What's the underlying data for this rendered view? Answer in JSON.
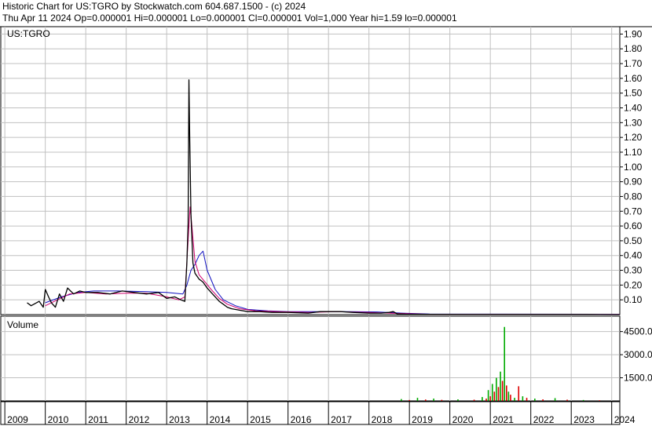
{
  "header": {
    "line1": "Historic Chart for US:TGRO by Stockwatch.com 604.687.1500 - (c) 2024",
    "line2": "Thu Apr 11 2024   Op=0.000001  Hi=0.000001  Lo=0.000001  Cl=0.000001  Vol=1,000  Year hi=1.59  lo=0.000001"
  },
  "colors": {
    "price": "#000000",
    "ma_short": "#d0006f",
    "ma_long": "#1010c0",
    "volume_up": "#00aa00",
    "volume_down": "#dd0000",
    "grid": "#c0c0c0"
  },
  "chart_data": [
    {
      "type": "line",
      "title": "US:TGRO",
      "ylim": [
        0,
        1.95
      ],
      "yticks": [
        "1.90",
        "1.80",
        "1.70",
        "1.60",
        "1.50",
        "1.40",
        "1.30",
        "1.20",
        "1.10",
        "1.00",
        "0.90",
        "0.80",
        "0.70",
        "0.60",
        "0.50",
        "0.40",
        "0.30",
        "0.20",
        "0.10"
      ],
      "grid": true,
      "x_tick_labels": [
        "2009",
        "2010",
        "2011",
        "2012",
        "2013",
        "2014",
        "2015",
        "2016",
        "2017",
        "2018",
        "2019",
        "2020",
        "2021",
        "2022",
        "2023",
        "2024"
      ],
      "xlim": [
        2008.9,
        2024.2
      ],
      "series": [
        {
          "role": "price",
          "x": [
            2009.55,
            2009.65,
            2009.85,
            2009.95,
            2010.0,
            2010.08,
            2010.15,
            2010.25,
            2010.35,
            2010.45,
            2010.55,
            2010.7,
            2010.85,
            2011.0,
            2011.3,
            2011.6,
            2011.9,
            2012.2,
            2012.5,
            2012.8,
            2013.0,
            2013.2,
            2013.35,
            2013.45,
            2013.5,
            2013.53,
            2013.55,
            2013.57,
            2013.6,
            2013.65,
            2013.7,
            2013.8,
            2013.9,
            2014.0,
            2014.1,
            2014.2,
            2014.3,
            2014.4,
            2014.5,
            2014.6,
            2014.8,
            2015.0,
            2015.3,
            2015.6,
            2016.0,
            2016.5,
            2016.8,
            2017.0,
            2017.3,
            2017.6,
            2018.0,
            2018.3,
            2018.5,
            2018.6,
            2018.7,
            2018.9,
            2019.5,
            2020.5,
            2021.5,
            2022.5,
            2023.5,
            2024.2
          ],
          "y": [
            0.08,
            0.06,
            0.09,
            0.05,
            0.17,
            0.12,
            0.08,
            0.05,
            0.14,
            0.09,
            0.18,
            0.14,
            0.16,
            0.15,
            0.15,
            0.14,
            0.16,
            0.15,
            0.14,
            0.15,
            0.11,
            0.12,
            0.1,
            0.09,
            0.35,
            0.62,
            1.59,
            1.2,
            0.68,
            0.35,
            0.28,
            0.24,
            0.22,
            0.18,
            0.15,
            0.12,
            0.09,
            0.07,
            0.05,
            0.04,
            0.03,
            0.02,
            0.02,
            0.015,
            0.015,
            0.01,
            0.02,
            0.02,
            0.02,
            0.015,
            0.01,
            0.01,
            0.015,
            0.02,
            0.005,
            0.003,
            0.002,
            0.001,
            0.001,
            0.001,
            0.001,
            1e-06
          ]
        },
        {
          "role": "ma_short",
          "x": [
            2010.0,
            2010.3,
            2010.6,
            2011.0,
            2011.5,
            2012.0,
            2012.5,
            2013.0,
            2013.3,
            2013.45,
            2013.52,
            2013.58,
            2013.63,
            2013.7,
            2013.8,
            2013.95,
            2014.1,
            2014.3,
            2014.5,
            2014.8,
            2015.2,
            2015.8,
            2016.5,
            2017.2,
            2018.0,
            2018.7,
            2019.5,
            2024.2
          ],
          "y": [
            0.06,
            0.1,
            0.14,
            0.15,
            0.14,
            0.145,
            0.145,
            0.12,
            0.1,
            0.12,
            0.45,
            0.73,
            0.58,
            0.36,
            0.27,
            0.22,
            0.17,
            0.11,
            0.07,
            0.04,
            0.025,
            0.02,
            0.015,
            0.02,
            0.015,
            0.008,
            0.002,
            0.001
          ]
        },
        {
          "role": "ma_long",
          "x": [
            2010.0,
            2010.4,
            2010.8,
            2011.2,
            2011.8,
            2012.5,
            2013.0,
            2013.4,
            2013.5,
            2013.6,
            2013.7,
            2013.8,
            2013.9,
            2014.0,
            2014.2,
            2014.4,
            2014.7,
            2015.0,
            2015.5,
            2016.0,
            2016.8,
            2017.5,
            2018.2,
            2018.8,
            2019.5,
            2024.2
          ],
          "y": [
            0.08,
            0.12,
            0.15,
            0.16,
            0.16,
            0.155,
            0.15,
            0.14,
            0.2,
            0.3,
            0.34,
            0.4,
            0.43,
            0.3,
            0.17,
            0.1,
            0.06,
            0.035,
            0.025,
            0.02,
            0.02,
            0.02,
            0.018,
            0.01,
            0.004,
            0.002
          ]
        }
      ]
    },
    {
      "type": "bar",
      "title": "Volume",
      "ylim": [
        0,
        5500
      ],
      "yticks": [
        "4500.0",
        "3000.0",
        "1500.0"
      ],
      "grid": true,
      "xlim": [
        2008.9,
        2024.2
      ],
      "bars": [
        {
          "x": 2018.8,
          "v": 120,
          "dir": "up"
        },
        {
          "x": 2019.0,
          "v": 60,
          "dir": "down"
        },
        {
          "x": 2019.2,
          "v": 200,
          "dir": "up"
        },
        {
          "x": 2019.4,
          "v": 90,
          "dir": "down"
        },
        {
          "x": 2019.6,
          "v": 150,
          "dir": "up"
        },
        {
          "x": 2019.8,
          "v": 70,
          "dir": "down"
        },
        {
          "x": 2020.2,
          "v": 100,
          "dir": "up"
        },
        {
          "x": 2020.6,
          "v": 80,
          "dir": "down"
        },
        {
          "x": 2020.8,
          "v": 250,
          "dir": "up"
        },
        {
          "x": 2020.9,
          "v": 150,
          "dir": "down"
        },
        {
          "x": 2020.95,
          "v": 700,
          "dir": "up"
        },
        {
          "x": 2021.0,
          "v": 300,
          "dir": "down"
        },
        {
          "x": 2021.05,
          "v": 1100,
          "dir": "up"
        },
        {
          "x": 2021.1,
          "v": 600,
          "dir": "down"
        },
        {
          "x": 2021.15,
          "v": 1500,
          "dir": "up"
        },
        {
          "x": 2021.2,
          "v": 900,
          "dir": "down"
        },
        {
          "x": 2021.25,
          "v": 1900,
          "dir": "up"
        },
        {
          "x": 2021.3,
          "v": 1300,
          "dir": "down"
        },
        {
          "x": 2021.35,
          "v": 4800,
          "dir": "up"
        },
        {
          "x": 2021.4,
          "v": 1000,
          "dir": "down"
        },
        {
          "x": 2021.45,
          "v": 600,
          "dir": "up"
        },
        {
          "x": 2021.5,
          "v": 400,
          "dir": "down"
        },
        {
          "x": 2021.6,
          "v": 200,
          "dir": "up"
        },
        {
          "x": 2021.7,
          "v": 950,
          "dir": "down"
        },
        {
          "x": 2021.8,
          "v": 300,
          "dir": "up"
        },
        {
          "x": 2021.9,
          "v": 200,
          "dir": "down"
        },
        {
          "x": 2022.1,
          "v": 150,
          "dir": "up"
        },
        {
          "x": 2022.3,
          "v": 100,
          "dir": "down"
        },
        {
          "x": 2022.6,
          "v": 180,
          "dir": "up"
        },
        {
          "x": 2022.9,
          "v": 80,
          "dir": "down"
        },
        {
          "x": 2023.3,
          "v": 60,
          "dir": "up"
        },
        {
          "x": 2023.7,
          "v": 40,
          "dir": "down"
        }
      ]
    }
  ]
}
